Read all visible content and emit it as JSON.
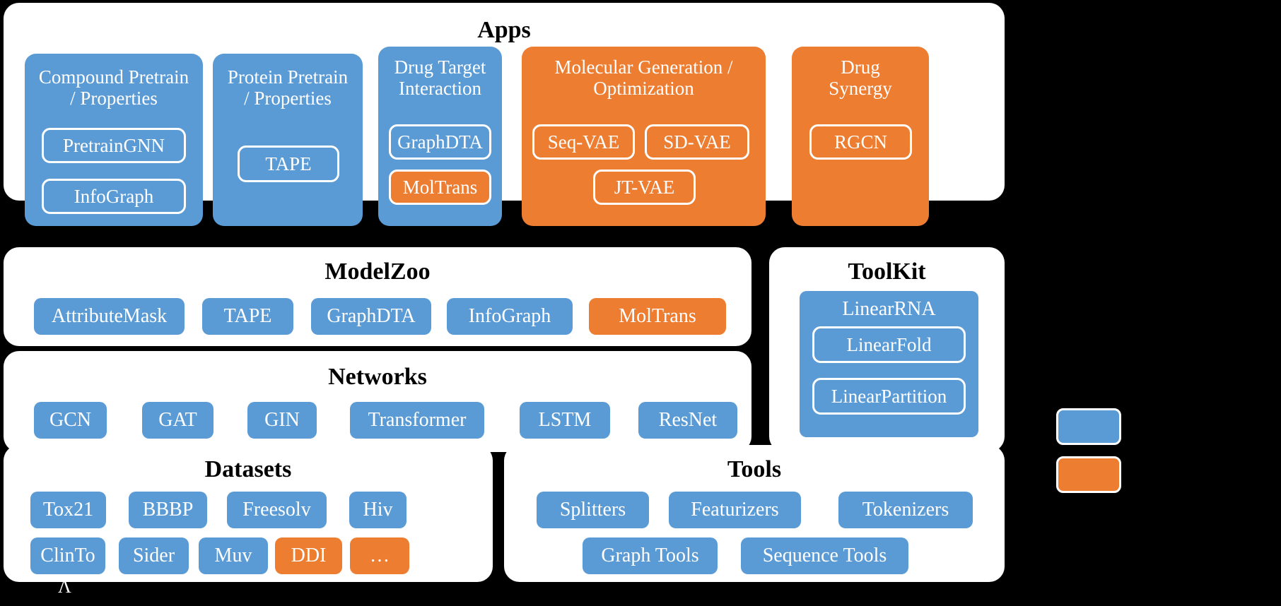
{
  "theme": {
    "background": "#000000",
    "panel_background": "#ffffff",
    "blue": "#5B9BD5",
    "orange": "#ED7D31",
    "chip_text": "#ffffff",
    "title_text": "#000000"
  },
  "apps": {
    "title": "Apps",
    "groups": [
      {
        "label": "Compound Pretrain\n/ Properties",
        "color": "blue",
        "items": [
          {
            "label": "PretrainGNN",
            "color": "blue"
          },
          {
            "label": "InfoGraph",
            "color": "blue"
          }
        ]
      },
      {
        "label": "Protein Pretrain\n/ Properties",
        "color": "blue",
        "items": [
          {
            "label": "TAPE",
            "color": "blue"
          }
        ]
      },
      {
        "label": "Drug Target\nInteraction",
        "color": "blue",
        "items": [
          {
            "label": "GraphDTA",
            "color": "blue"
          },
          {
            "label": "MolTrans",
            "color": "orange"
          }
        ]
      },
      {
        "label": "Molecular Generation /\nOptimization",
        "color": "orange",
        "items": [
          {
            "label": "Seq-VAE",
            "color": "orange"
          },
          {
            "label": "SD-VAE",
            "color": "orange"
          },
          {
            "label": "JT-VAE",
            "color": "orange"
          }
        ]
      },
      {
        "label": "Drug\nSynergy",
        "color": "orange",
        "items": [
          {
            "label": "RGCN",
            "color": "orange"
          }
        ]
      }
    ]
  },
  "modelzoo": {
    "title": "ModelZoo",
    "items": [
      {
        "label": "AttributeMask",
        "color": "blue"
      },
      {
        "label": "TAPE",
        "color": "blue"
      },
      {
        "label": "GraphDTA",
        "color": "blue"
      },
      {
        "label": "InfoGraph",
        "color": "blue"
      },
      {
        "label": "MolTrans",
        "color": "orange"
      }
    ]
  },
  "networks": {
    "title": "Networks",
    "items": [
      {
        "label": "GCN",
        "color": "blue"
      },
      {
        "label": "GAT",
        "color": "blue"
      },
      {
        "label": "GIN",
        "color": "blue"
      },
      {
        "label": "Transformer",
        "color": "blue"
      },
      {
        "label": "LSTM",
        "color": "blue"
      },
      {
        "label": "ResNet",
        "color": "blue"
      }
    ]
  },
  "toolkit": {
    "title": "ToolKit",
    "group_label": "LinearRNA",
    "items": [
      {
        "label": "LinearFold",
        "color": "blue"
      },
      {
        "label": "LinearPartition",
        "color": "blue"
      }
    ]
  },
  "datasets": {
    "title": "Datasets",
    "row1": [
      {
        "label": "Tox21",
        "color": "blue"
      },
      {
        "label": "BBBP",
        "color": "blue"
      },
      {
        "label": "Freesolv",
        "color": "blue"
      },
      {
        "label": "Hiv",
        "color": "blue"
      }
    ],
    "row2": [
      {
        "label": "ClinTo",
        "color": "blue"
      },
      {
        "label": "Sider",
        "color": "blue"
      },
      {
        "label": "Muv",
        "color": "blue"
      },
      {
        "label": "DDI",
        "color": "orange"
      },
      {
        "label": "…",
        "color": "orange"
      }
    ]
  },
  "tools": {
    "title": "Tools",
    "row1": [
      {
        "label": "Splitters",
        "color": "blue"
      },
      {
        "label": "Featurizers",
        "color": "blue"
      },
      {
        "label": "Tokenizers",
        "color": "blue"
      }
    ],
    "row2": [
      {
        "label": "Graph Tools",
        "color": "blue"
      },
      {
        "label": "Sequence Tools",
        "color": "blue"
      }
    ]
  },
  "legend": {
    "swatches": [
      {
        "color": "blue"
      },
      {
        "color": "orange"
      }
    ]
  },
  "artifact": {
    "glyph": "Λ"
  }
}
